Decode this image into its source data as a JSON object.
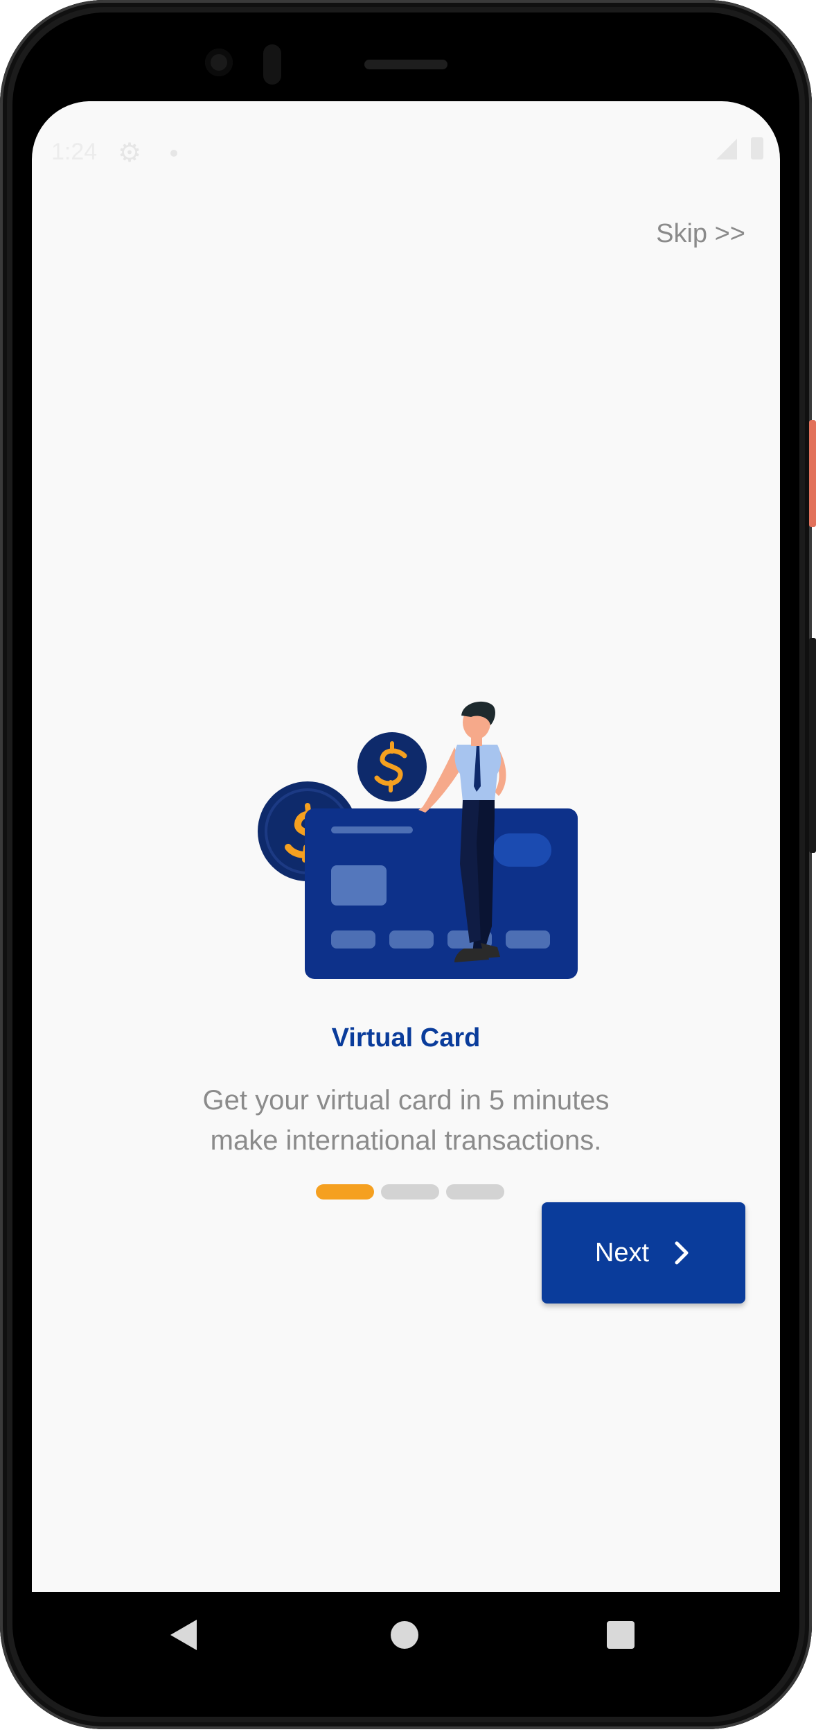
{
  "status_bar": {
    "time": "1:24",
    "settings_icon": "gear-icon",
    "signal_icon": "signal-icon",
    "battery_icon": "battery-icon"
  },
  "onboarding": {
    "skip_label": "Skip >>",
    "title": "Virtual Card",
    "description_line1": "Get your virtual card in 5 minutes",
    "description_line2": "make international transactions.",
    "page_indicator": {
      "total": 3,
      "active_index": 0
    },
    "next_label": "Next",
    "next_icon": "chevron-right-icon"
  },
  "colors": {
    "brand_blue": "#0a3c9b",
    "accent_orange": "#f5a020",
    "inactive_dot": "#d3d3d3",
    "background": "#f9f9f9",
    "muted_text": "#8b8b8b"
  },
  "navigation_bar": {
    "back_icon": "back-triangle-icon",
    "home_icon": "home-circle-icon",
    "recents_icon": "recents-square-icon"
  }
}
